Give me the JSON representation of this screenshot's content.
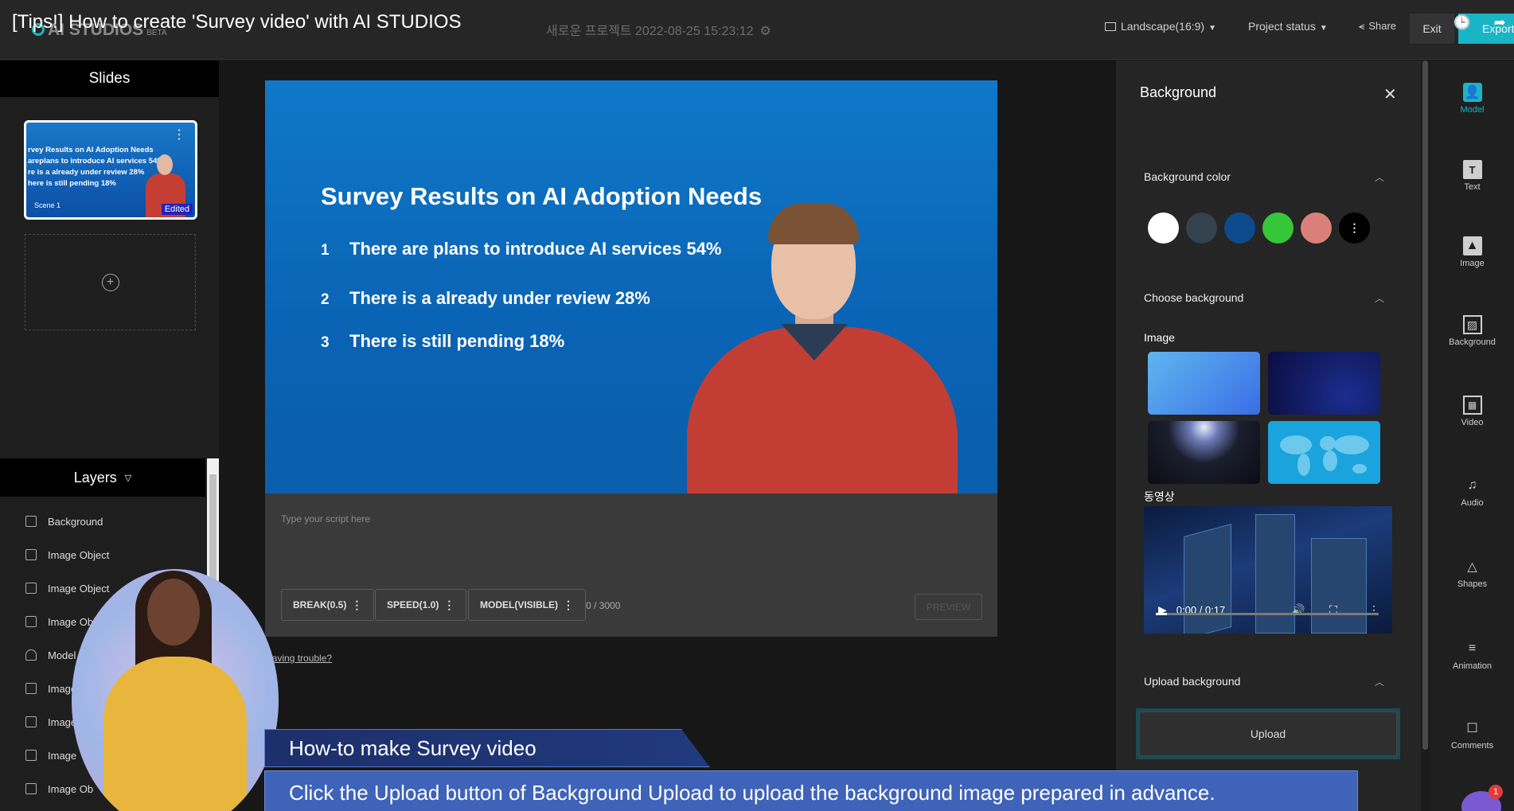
{
  "video_title": "[Tips!] How to create 'Survey video' with AI STUDIOS",
  "app": {
    "logo_text": "AI STUDIOS",
    "logo_badge": "BETA",
    "project_name": "새로운 프로젝트 2022-08-25 15:23:12"
  },
  "toolbar": {
    "aspect": "Landscape(16:9)",
    "project_status": "Project status",
    "share": "Share",
    "exit": "Exit",
    "export": "Export"
  },
  "slides": {
    "header": "Slides",
    "thumb_lines": [
      "rvey Results on AI Adoption Needs",
      "areplans to introduce AI services 54%",
      "re is a already under review 28%",
      "here is still pending 18%"
    ],
    "scene_label": "Scene 1",
    "edited_badge": "Edited"
  },
  "layers": {
    "header": "Layers",
    "items": [
      "Background",
      "Image Object",
      "Image Object",
      "Image Object",
      "Model",
      "Image",
      "Image",
      "Image",
      "Image Ob"
    ]
  },
  "stage": {
    "title": "Survey Results on AI Adoption Needs",
    "lines": [
      {
        "num": "1",
        "text": "There are plans to introduce AI services 54%"
      },
      {
        "num": "2",
        "text": "There is a already under review 28%"
      },
      {
        "num": "3",
        "text": "There is still pending 18%"
      }
    ]
  },
  "script": {
    "placeholder": "Type your script here",
    "break_btn": "BREAK(0.5)",
    "speed_btn": "SPEED(1.0)",
    "model_btn": "MODEL(VISIBLE)",
    "char_count": "0 / 3000",
    "preview_btn": "PREVIEW",
    "trouble_link": "Having trouble?"
  },
  "background_panel": {
    "title": "Background",
    "color_section": "Background color",
    "colors": [
      "#ffffff",
      "#34424d",
      "#0d4a8c",
      "#35c63a",
      "#d9807a"
    ],
    "choose_section": "Choose background",
    "image_label": "Image",
    "video_label": "동영상",
    "video_time": "0:00 / 0:17",
    "video_progress": 0.05,
    "upload_section": "Upload background",
    "upload_btn": "Upload"
  },
  "rail": {
    "items": [
      {
        "label": "Model",
        "icon": "model-icon"
      },
      {
        "label": "Text",
        "icon": "text-icon"
      },
      {
        "label": "Image",
        "icon": "image-icon"
      },
      {
        "label": "Background",
        "icon": "background-icon"
      },
      {
        "label": "Video",
        "icon": "video-icon"
      },
      {
        "label": "Audio",
        "icon": "audio-icon"
      },
      {
        "label": "Shapes",
        "icon": "shapes-icon"
      },
      {
        "label": "Animation",
        "icon": "animation-icon"
      },
      {
        "label": "Comments",
        "icon": "comments-icon"
      }
    ]
  },
  "captions": {
    "title": "How-to make Survey video",
    "subtitle": "Click the Upload button of Background Upload to upload the background image prepared in advance."
  },
  "chat_badge": "1"
}
